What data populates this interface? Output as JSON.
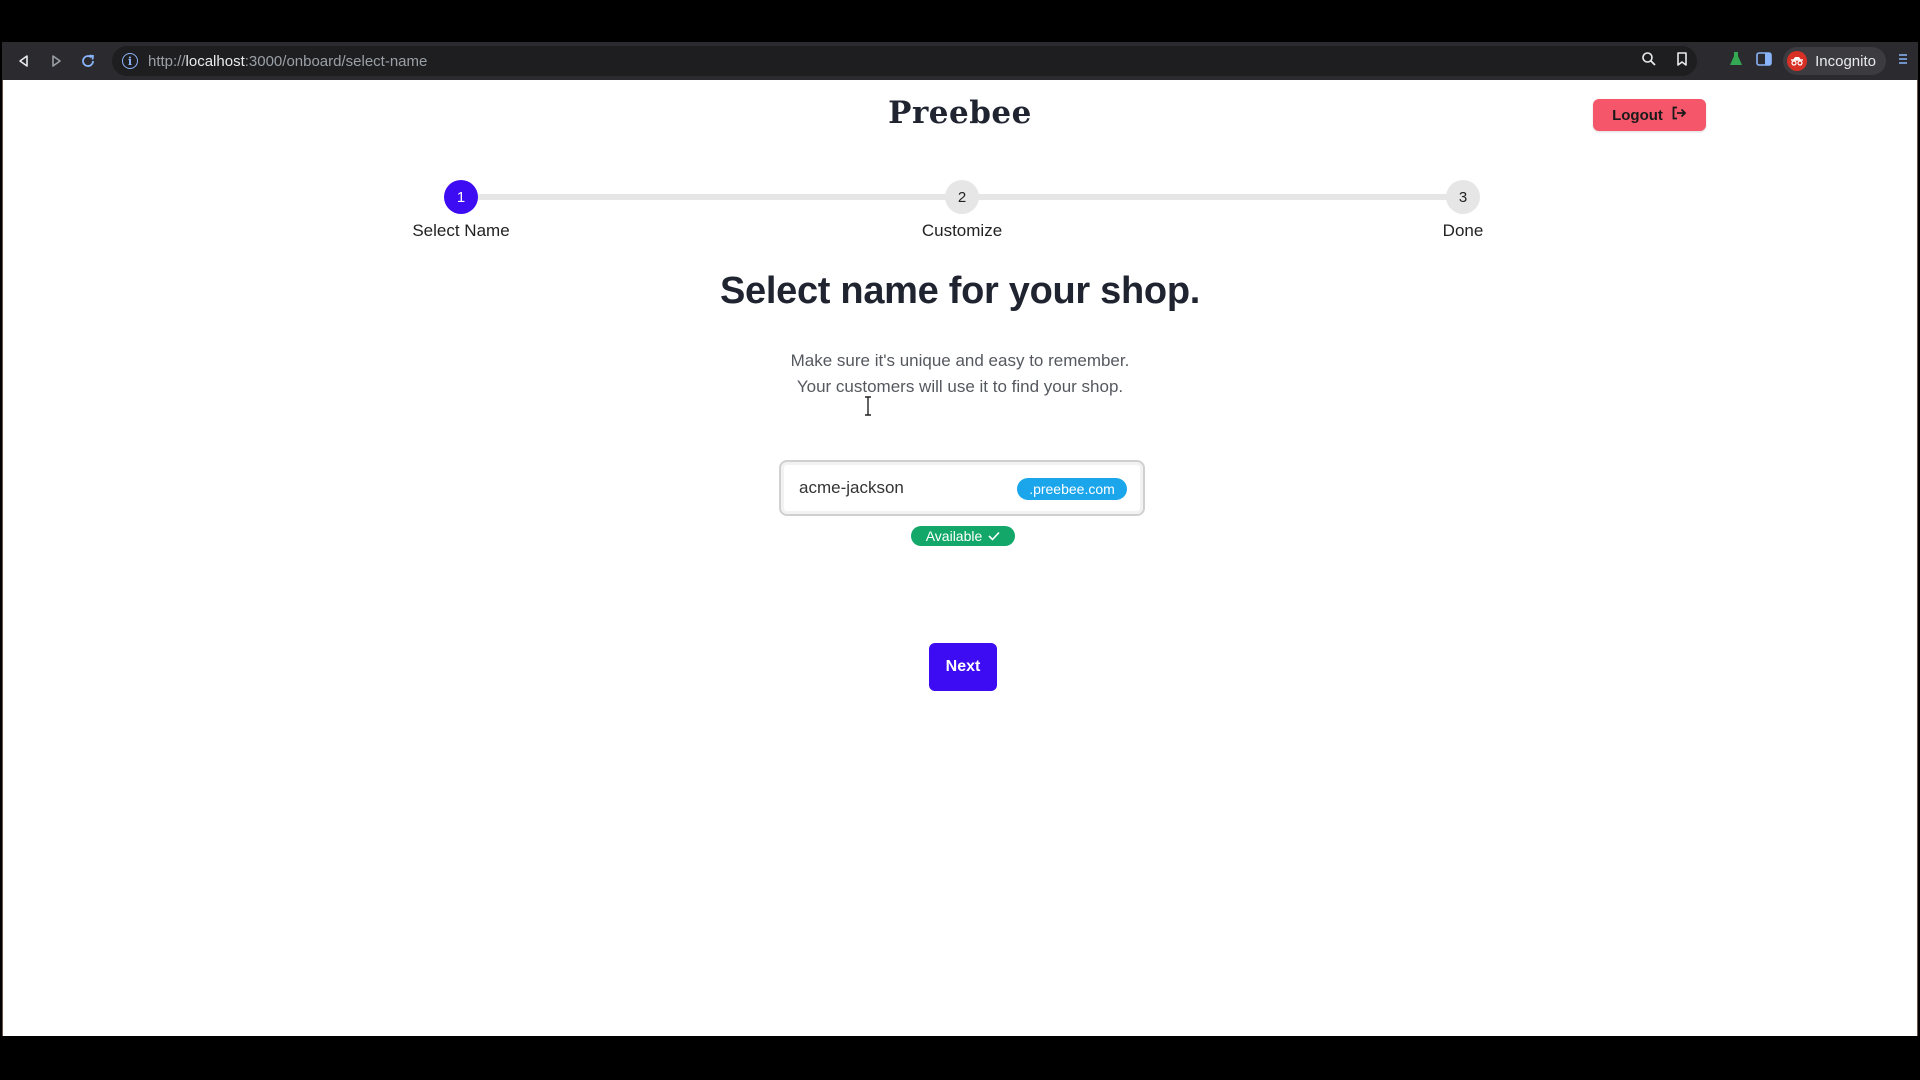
{
  "browser": {
    "url_scheme": "http://",
    "url_host": "localhost",
    "url_path": ":3000/onboard/select-name",
    "profile_label": "Incognito"
  },
  "header": {
    "brand": "Preebee",
    "logout_label": "Logout"
  },
  "stepper": {
    "steps": [
      {
        "number": "1",
        "label": "Select Name",
        "state": "active"
      },
      {
        "number": "2",
        "label": "Customize",
        "state": "pending"
      },
      {
        "number": "3",
        "label": "Done",
        "state": "pending"
      }
    ]
  },
  "main": {
    "title": "Select name for your shop.",
    "subtitle_line1": "Make sure it's unique and easy to remember.",
    "subtitle_line2": "Your customers will use it to find your shop.",
    "shop_name_value": "acme-jackson",
    "domain_suffix": ".preebee.com",
    "availability": "Available",
    "next_label": "Next"
  },
  "colors": {
    "primary": "#3d0cf2",
    "logout": "#f5566a",
    "domain_badge": "#1ba6ec",
    "available": "#13a86a"
  }
}
